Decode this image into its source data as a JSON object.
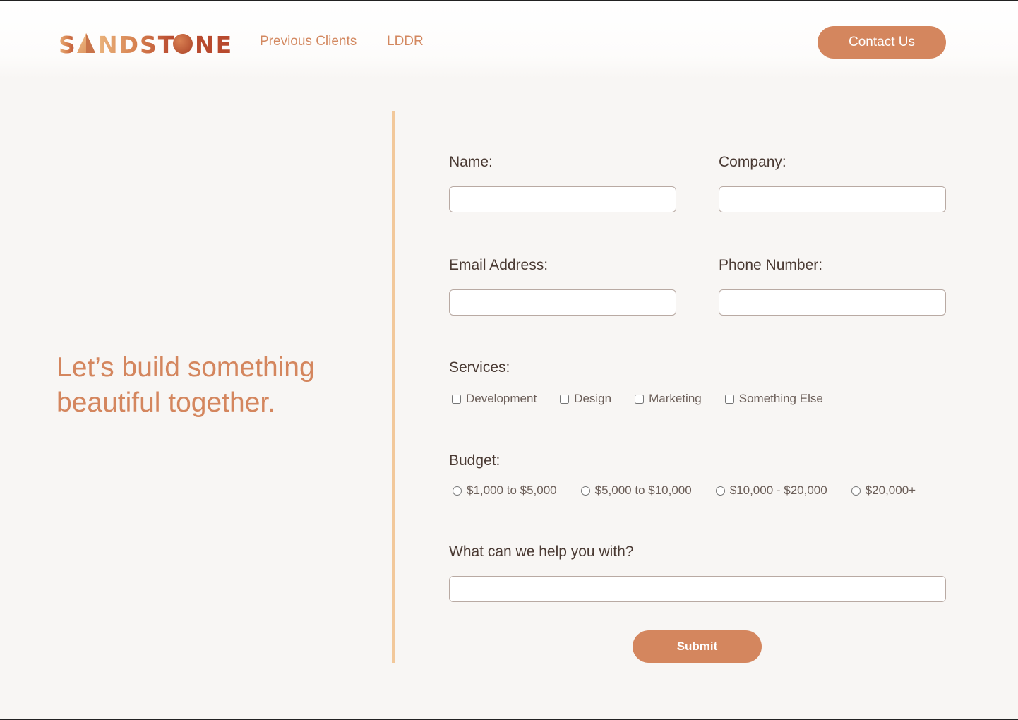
{
  "header": {
    "logo_text": "SANDSTONE",
    "nav": [
      {
        "label": "Previous Clients"
      },
      {
        "label": "LDDR"
      }
    ],
    "contact_label": "Contact Us"
  },
  "hero": {
    "tagline": "Let’s build something beautiful together."
  },
  "form": {
    "name_label": "Name:",
    "company_label": "Company:",
    "email_label": "Email Address:",
    "phone_label": "Phone Number:",
    "services_label": "Services:",
    "services": [
      "Development",
      "Design",
      "Marketing",
      "Something Else"
    ],
    "budget_label": "Budget:",
    "budgets": [
      "$1,000 to $5,000",
      "$5,000 to $10,000",
      "$10,000 - $20,000",
      "$20,000+"
    ],
    "help_label": "What can we help you with?",
    "submit_label": "Submit"
  },
  "colors": {
    "accent": "#d4865e",
    "divider": "#f2c89a",
    "background": "#f8f6f4",
    "logo_gradient_start": "#e8b07a",
    "logo_gradient_end": "#b84a2e"
  }
}
